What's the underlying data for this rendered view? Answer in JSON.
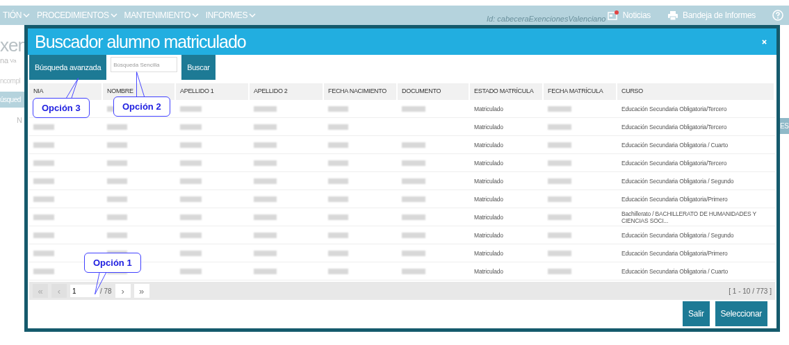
{
  "nav": {
    "menus": [
      {
        "label": "TIÓN"
      },
      {
        "label": "PROCEDIMIENTOS"
      },
      {
        "label": "MANTENIMIENTO"
      },
      {
        "label": "INFORMES"
      }
    ],
    "links": [
      {
        "label": "Noticias",
        "kind": "news"
      },
      {
        "label": "Bandeja de Informes",
        "kind": "print"
      },
      {
        "kind": "help"
      }
    ],
    "faint_id": "Id: cabeceraExencionesValenciano"
  },
  "background": {
    "title": "xen",
    "tab": "na",
    "small": "Va",
    "subtitle": "ncompl",
    "bar": "úsqued",
    "field": "N",
    "bar_right": "ES"
  },
  "dialog": {
    "title": "Buscador alumno matriculado",
    "advanced_button": "Búsqueda avanzada",
    "search": {
      "placeholder": "Búsqueda Sencilla"
    },
    "search_button": "Buscar",
    "columns": [
      "NIA",
      "NOMBRE",
      "APELLIDO 1",
      "APELLIDO 2",
      "FECHA NACIMIENTO",
      "DOCUMENTO",
      "ESTADO MATRÍCULA",
      "FECHA MATRÍCULA",
      "CURSO"
    ],
    "rows": [
      {
        "documento_shown": true,
        "estado": "Matriculado",
        "curso": "Educación Secundaria Obligatoria/Tercero"
      },
      {
        "documento_shown": false,
        "estado": "Matriculado",
        "curso": "Educación Secundaria Obligatoria/Tercero"
      },
      {
        "documento_shown": true,
        "estado": "Matriculado",
        "curso": "Educación Secundaria Obligatoria / Cuarto"
      },
      {
        "documento_shown": true,
        "estado": "Matriculado",
        "curso": "Educación Secundaria Obligatoria/Tercero"
      },
      {
        "documento_shown": true,
        "estado": "Matriculado",
        "curso": "Educación Secundaria Obligatoria / Segundo"
      },
      {
        "documento_shown": true,
        "estado": "Matriculado",
        "curso": "Educación Secundaria Obligatoria/Primero"
      },
      {
        "documento_shown": true,
        "estado": "Matriculado",
        "curso": "Bachillerato / BACHILLERATO DE HUMANIDADES Y CIENCIAS SOCI..."
      },
      {
        "documento_shown": true,
        "estado": "Matriculado",
        "curso": "Educación Secundaria Obligatoria / Segundo"
      },
      {
        "documento_shown": true,
        "estado": "Matriculado",
        "curso": "Educación Secundaria Obligatoria/Primero"
      },
      {
        "documento_shown": true,
        "estado": "Matriculado",
        "curso": "Educación Secundaria Obligatoria / Cuarto"
      }
    ],
    "pager": {
      "first": "«",
      "prev": "‹",
      "page": "1",
      "total": "/ 78",
      "next": "›",
      "last": "»",
      "range": "[ 1 - 10 / 773 ]"
    },
    "buttons": [
      "Salir",
      "Seleccionar"
    ]
  },
  "callouts": [
    {
      "label": "Opción 3"
    },
    {
      "label": "Opción 2"
    },
    {
      "label": "Opción 1"
    }
  ]
}
